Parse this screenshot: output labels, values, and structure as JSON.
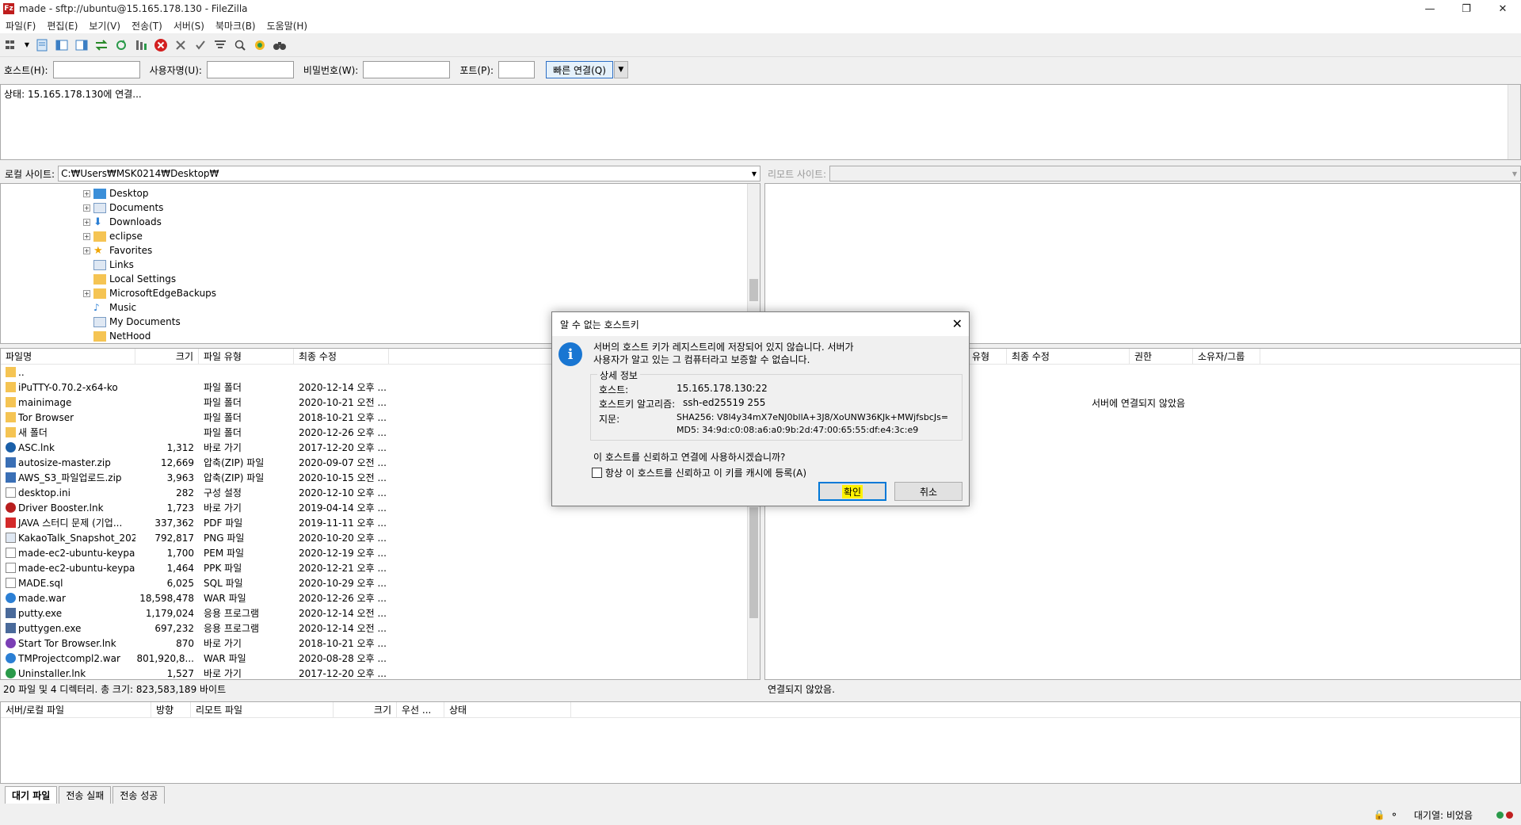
{
  "window": {
    "title": "made - sftp://ubuntu@15.165.178.130 - FileZilla",
    "app_icon": "Fz"
  },
  "menu": [
    "파일(F)",
    "편집(E)",
    "보기(V)",
    "전송(T)",
    "서버(S)",
    "북마크(B)",
    "도움말(H)"
  ],
  "quickconnect": {
    "host_label": "호스트(H):",
    "host_value": "",
    "user_label": "사용자명(U):",
    "user_value": "",
    "pass_label": "비밀번호(W):",
    "pass_value": "",
    "port_label": "포트(P):",
    "port_value": "",
    "connect_button": "빠른 연결(Q)"
  },
  "log": {
    "line1": "상태:    15.165.178.130에 연결..."
  },
  "local": {
    "site_label": "로컬 사이트:",
    "path": "C:₩Users₩MSK0214₩Desktop₩",
    "tree": [
      {
        "label": "Desktop",
        "icon": "desktop-folder-icon",
        "expander": "+"
      },
      {
        "label": "Documents",
        "icon": "documents-icon",
        "expander": "+"
      },
      {
        "label": "Downloads",
        "icon": "downloads-icon",
        "expander": "+"
      },
      {
        "label": "eclipse",
        "icon": "folder-icon",
        "expander": "+"
      },
      {
        "label": "Favorites",
        "icon": "favorites-icon",
        "expander": "+"
      },
      {
        "label": "Links",
        "icon": "links-icon",
        "expander": ""
      },
      {
        "label": "Local Settings",
        "icon": "folder-icon",
        "expander": ""
      },
      {
        "label": "MicrosoftEdgeBackups",
        "icon": "folder-icon",
        "expander": "+"
      },
      {
        "label": "Music",
        "icon": "music-icon",
        "expander": ""
      },
      {
        "label": "My Documents",
        "icon": "documents-icon",
        "expander": ""
      },
      {
        "label": "NetHood",
        "icon": "folder-icon",
        "expander": ""
      }
    ],
    "columns": [
      "파일명",
      "크기",
      "파일 유형",
      "최종 수정"
    ],
    "files": [
      {
        "name": "..",
        "size": "",
        "type": "",
        "modified": "",
        "icon": "folder"
      },
      {
        "name": "iPuTTY-0.70.2-x64-ko",
        "size": "",
        "type": "파일 폴더",
        "modified": "2020-12-14 오후 ...",
        "icon": "folder"
      },
      {
        "name": "mainimage",
        "size": "",
        "type": "파일 폴더",
        "modified": "2020-10-21 오전 ...",
        "icon": "folder"
      },
      {
        "name": "Tor Browser",
        "size": "",
        "type": "파일 폴더",
        "modified": "2018-10-21 오후 ...",
        "icon": "folder"
      },
      {
        "name": "새 폴더",
        "size": "",
        "type": "파일 폴더",
        "modified": "2020-12-26 오후 ...",
        "icon": "folder"
      },
      {
        "name": "ASC.lnk",
        "size": "1,312",
        "type": "바로 가기",
        "modified": "2017-12-20 오후 ...",
        "icon": "lnk-blue"
      },
      {
        "name": "autosize-master.zip",
        "size": "12,669",
        "type": "압축(ZIP) 파일",
        "modified": "2020-09-07 오전 ...",
        "icon": "zip"
      },
      {
        "name": "AWS_S3_파일업로드.zip",
        "size": "3,963",
        "type": "압축(ZIP) 파일",
        "modified": "2020-10-15 오전 ...",
        "icon": "zip"
      },
      {
        "name": "desktop.ini",
        "size": "282",
        "type": "구성 설정",
        "modified": "2020-12-10 오후 ...",
        "icon": "ini"
      },
      {
        "name": "Driver Booster.lnk",
        "size": "1,723",
        "type": "바로 가기",
        "modified": "2019-04-14 오후 ...",
        "icon": "lnk-red"
      },
      {
        "name": "JAVA 스터디 문제 (기업...",
        "size": "337,362",
        "type": "PDF 파일",
        "modified": "2019-11-11 오후 ...",
        "icon": "pdf"
      },
      {
        "name": "KakaoTalk_Snapshot_202...",
        "size": "792,817",
        "type": "PNG 파일",
        "modified": "2020-10-20 오후 ...",
        "icon": "png"
      },
      {
        "name": "made-ec2-ubuntu-keypai...",
        "size": "1,700",
        "type": "PEM 파일",
        "modified": "2020-12-19 오후 ...",
        "icon": "blank"
      },
      {
        "name": "made-ec2-ubuntu-keypai...",
        "size": "1,464",
        "type": "PPK 파일",
        "modified": "2020-12-21 오후 ...",
        "icon": "blank"
      },
      {
        "name": "MADE.sql",
        "size": "6,025",
        "type": "SQL 파일",
        "modified": "2020-10-29 오후 ...",
        "icon": "blank"
      },
      {
        "name": "made.war",
        "size": "18,598,478",
        "type": "WAR 파일",
        "modified": "2020-12-26 오후 ...",
        "icon": "war"
      },
      {
        "name": "putty.exe",
        "size": "1,179,024",
        "type": "응용 프로그램",
        "modified": "2020-12-14 오전 ...",
        "icon": "exe"
      },
      {
        "name": "puttygen.exe",
        "size": "697,232",
        "type": "응용 프로그램",
        "modified": "2020-12-14 오전 ...",
        "icon": "exe"
      },
      {
        "name": "Start Tor Browser.lnk",
        "size": "870",
        "type": "바로 가기",
        "modified": "2018-10-21 오후 ...",
        "icon": "lnk-purple"
      },
      {
        "name": "TMProjectcompl2.war",
        "size": "801,920,8...",
        "type": "WAR 파일",
        "modified": "2020-08-28 오후 ...",
        "icon": "war"
      },
      {
        "name": "Uninstaller.lnk",
        "size": "1,527",
        "type": "바로 가기",
        "modified": "2017-12-20 오후 ...",
        "icon": "lnk-green"
      }
    ],
    "summary": "20 파일 및 4 디렉터리. 총 크기: 823,583,189 바이트"
  },
  "remote": {
    "site_label": "리모트 사이트:",
    "columns": [
      "유형",
      "최종 수정",
      "권한",
      "소유자/그룹"
    ],
    "not_connected_msg": "서버에 연결되지 않았음",
    "status": "연결되지 않았음."
  },
  "queue": {
    "columns": [
      "서버/로컬 파일",
      "방향",
      "리모트 파일",
      "크기",
      "우선 ...",
      "상태"
    ],
    "tabs": [
      "대기 파일",
      "전송 실패",
      "전송 성공"
    ]
  },
  "statusbar": {
    "queue_text": "대기열: 비었음"
  },
  "dialog": {
    "title": "알 수 없는 호스트키",
    "message_line1": "서버의 호스트 키가 레지스트리에 저장되어 있지 않습니다. 서버가",
    "message_line2": "사용자가 알고 있는 그 컴퓨터라고 보증할 수 없습니다.",
    "group_label": "상세 정보",
    "host_label": "호스트:",
    "host_value": "15.165.178.130:22",
    "algo_label": "호스트키 알고리즘:",
    "algo_value": "ssh-ed25519 255",
    "fp_label": "지문:",
    "fp_sha": "SHA256: V8l4y34mX7eNJ0bllA+3J8/XoUNW36KJk+MWjfsbcJs=",
    "fp_md5": "MD5: 34:9d:c0:08:a6:a0:9b:2d:47:00:65:55:df:e4:3c:e9",
    "question": "이 호스트를 신뢰하고 연결에 사용하시겠습니까?",
    "checkbox_label": "항상 이 호스트를 신뢰하고 이 키를 캐시에 등록(A)",
    "ok_button": "확인",
    "cancel_button": "취소"
  }
}
